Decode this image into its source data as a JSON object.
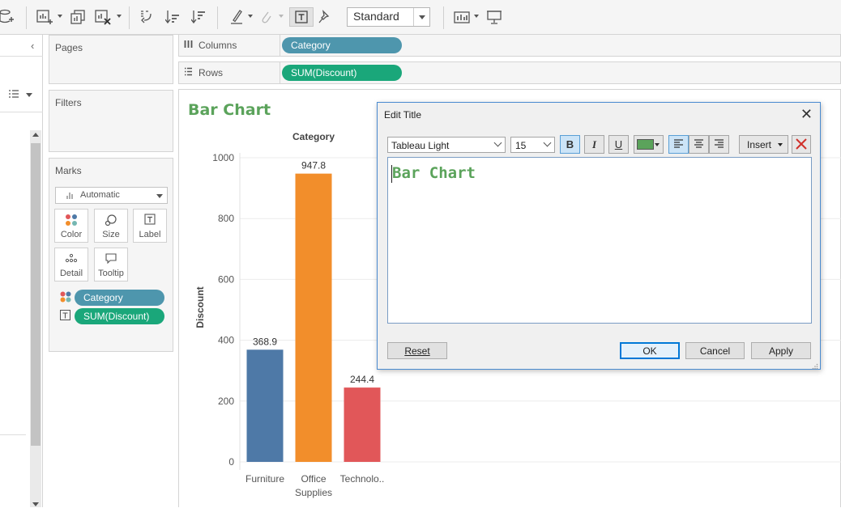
{
  "toolbar": {
    "view_mode": "Standard",
    "icons": [
      "new-data-source-icon",
      "new-worksheet-icon",
      "duplicate-icon",
      "clear-icon",
      "swap-icon",
      "sort-ascending-icon",
      "sort-descending-icon",
      "highlight-icon",
      "group-icon",
      "show-labels-icon",
      "pin-icon",
      "show-me-icon",
      "presentation-icon"
    ]
  },
  "cards": {
    "pages_title": "Pages",
    "filters_title": "Filters",
    "marks_title": "Marks",
    "mark_type": "Automatic",
    "mark_buttons": [
      {
        "label": "Color",
        "icon": "color-dots-icon"
      },
      {
        "label": "Size",
        "icon": "size-icon"
      },
      {
        "label": "Label",
        "icon": "label-icon"
      },
      {
        "label": "Detail",
        "icon": "detail-icon"
      },
      {
        "label": "Tooltip",
        "icon": "tooltip-icon"
      }
    ],
    "mark_pills": [
      {
        "label": "Category",
        "icon": "color-dots-icon",
        "color": "#4e96ad"
      },
      {
        "label": "SUM(Discount)",
        "icon": "label-icon",
        "color": "#1aa77a"
      }
    ]
  },
  "shelves": {
    "columns_label": "Columns",
    "columns_pill": "Category",
    "rows_label": "Rows",
    "rows_pill": "SUM(Discount)"
  },
  "viz": {
    "title": "Bar Chart",
    "title_color": "#5ba35b"
  },
  "chart_data": {
    "type": "bar",
    "title": "Bar Chart",
    "xlabel": "Category",
    "ylabel": "Discount",
    "categories": [
      "Furniture",
      "Office Supplies",
      "Technolo.."
    ],
    "category_tick_lines": [
      [
        "Furniture"
      ],
      [
        "Office",
        "Supplies"
      ],
      [
        "Technolo.."
      ]
    ],
    "values": [
      368.9,
      947.8,
      244.4
    ],
    "data_labels": [
      "368.9",
      "947.8",
      "244.4"
    ],
    "colors": [
      "#4e79a7",
      "#f28e2b",
      "#e15759"
    ],
    "ylim": [
      0,
      1000
    ],
    "yticks": [
      0,
      200,
      400,
      600,
      800,
      1000
    ],
    "grid": true,
    "legend": "none"
  },
  "dialog": {
    "title": "Edit Title",
    "font": "Tableau Light",
    "size": "15",
    "bold_label": "B",
    "italic_label": "I",
    "underline_label": "U",
    "text_color": "#5ba35b",
    "insert_label": "Insert",
    "content": "Bar Chart",
    "reset_label": "Reset",
    "ok_label": "OK",
    "cancel_label": "Cancel",
    "apply_label": "Apply"
  }
}
